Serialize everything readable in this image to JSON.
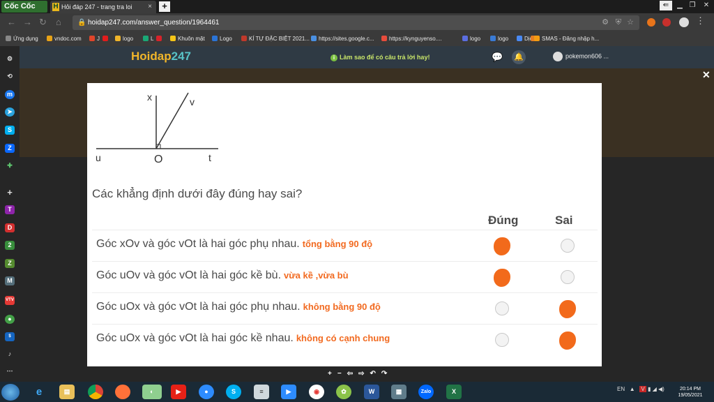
{
  "browser": {
    "brand": "Cốc Cốc",
    "tab_title": "Hỏi đáp 247 - trang tra loi",
    "tab_icon_letter": "H",
    "tab_close": "×",
    "new_tab": "+",
    "url": "hoidap247.com/answer_question/1964461"
  },
  "bookmarks": [
    {
      "label": "Ứng dụng",
      "color": "#888888"
    },
    {
      "label": "vndoc.com",
      "color": "#e8a317"
    },
    {
      "label": "J",
      "color": "#e0452a"
    },
    {
      "label": "",
      "color": "#e21c1c"
    },
    {
      "label": "logo",
      "color": "#f0b52a"
    },
    {
      "label": "L",
      "color": "#1aa876"
    },
    {
      "label": "",
      "color": "#d8232a"
    },
    {
      "label": "Khuôn mặt",
      "color": "#f5c518"
    },
    {
      "label": "Logo",
      "color": "#2b74d6"
    },
    {
      "label": "KÍ TỰ ĐẶC BIỆT 2021...",
      "color": "#c0392b"
    },
    {
      "label": "https://sites.google.c...",
      "color": "#4a90e2"
    },
    {
      "label": "https://kynguyenso....",
      "color": "#e74c3c"
    },
    {
      "label": "logo",
      "color": "#5b6ee1"
    },
    {
      "label": "logo",
      "color": "#3a7bd5"
    },
    {
      "label": "Dịch",
      "color": "#4a8af4"
    },
    {
      "label": "",
      "color": "#e67e22"
    },
    {
      "label": "SMAS - Đăng nhập h...",
      "color": "#f39c12"
    }
  ],
  "site": {
    "logo_a": "Hoidap",
    "logo_b": "247",
    "tip": "Làm sao để có câu trả lời hay!",
    "username": "pokemon606 ..."
  },
  "figure": {
    "label_x": "x",
    "label_v": "v",
    "label_u": "u",
    "label_o": "O",
    "label_t": "t"
  },
  "question": "Các khẳng định dưới đây đúng hay sai?",
  "columns": {
    "true": "Đúng",
    "false": "Sai"
  },
  "statements": [
    {
      "text": "Góc xOv và góc vOt là hai góc phụ nhau.",
      "note": "tổng bằng 90 độ",
      "marked": "true"
    },
    {
      "text": "Góc uOv và góc vOt là hai góc kề bù.",
      "note": "vừa kề ,vừa bù",
      "marked": "true"
    },
    {
      "text": "Góc uOx và góc vOt là hai góc phụ nhau.",
      "note": "không bằng 90 độ",
      "marked": "false"
    },
    {
      "text": "Góc uOx và góc vOt là hai góc kề nhau.",
      "note": "không có cạnh chung",
      "marked": "false"
    }
  ],
  "viewer_tools": [
    "+",
    "−",
    "⇦",
    "⇨",
    "↶",
    "↷"
  ],
  "colors": {
    "annotation": "#f26a20",
    "brand_green": "#2f6f2f",
    "logo_gold": "#f0b52a",
    "logo_teal": "#58c3c7"
  },
  "taskbar": {
    "lang": "EN",
    "time": "20:14 PM",
    "date": "19/05/2021"
  }
}
